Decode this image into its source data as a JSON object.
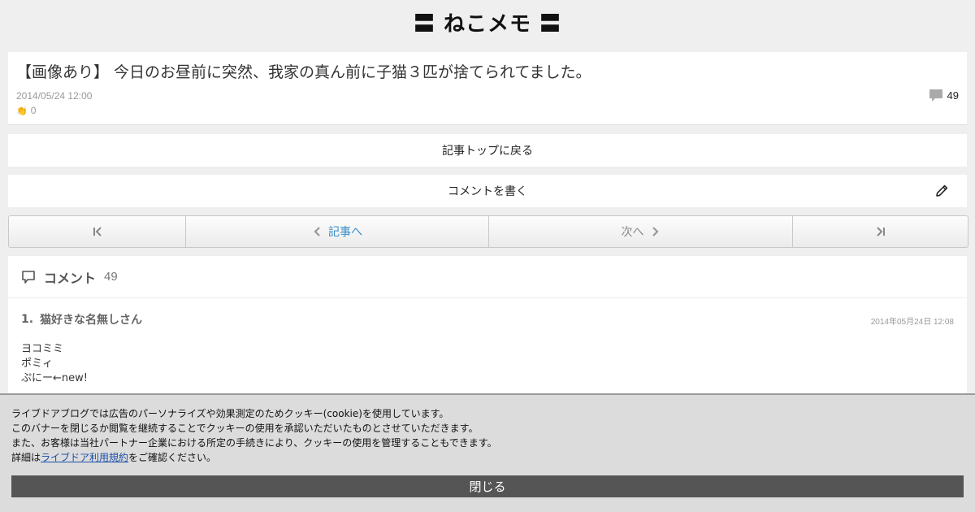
{
  "site": {
    "title": "〓 ねこメモ 〓"
  },
  "article": {
    "title": "【画像あり】 今日のお昼前に突然、我家の真ん前に子猫３匹が捨てられてました。",
    "date": "2014/05/24 12:00",
    "claps": "0",
    "comment_count": "49"
  },
  "nav": {
    "back_to_top": "記事トップに戻る",
    "write_comment": "コメントを書く"
  },
  "pager": {
    "prev_label": "記事へ",
    "next_label": "次へ"
  },
  "comments": {
    "heading": "コメント",
    "count": "49",
    "items": [
      {
        "number": "1.",
        "author": "猫好きな名無しさん",
        "time": "2014年05月24日 12:08",
        "lines": [
          "ヨコミミ",
          "ポミィ",
          "ぷにー←new!"
        ]
      }
    ]
  },
  "cookie": {
    "line1": "ライブドアブログでは広告のパーソナライズや効果測定のためクッキー(cookie)を使用しています。",
    "line2": "このバナーを閉じるか閲覧を継続することでクッキーの使用を承認いただいたものとさせていただきます。",
    "line3": "また、お客様は当社パートナー企業における所定の手続きにより、クッキーの使用を管理することもできます。",
    "line4_prefix": "詳細は",
    "link_text": "ライブドア利用規約",
    "line4_suffix": "をご確認ください。",
    "close_label": "閉じる"
  },
  "colors": {
    "background": "#efefef",
    "link": "#3a8fc8",
    "banner": "#dcdcdc",
    "close_button": "#555555"
  }
}
